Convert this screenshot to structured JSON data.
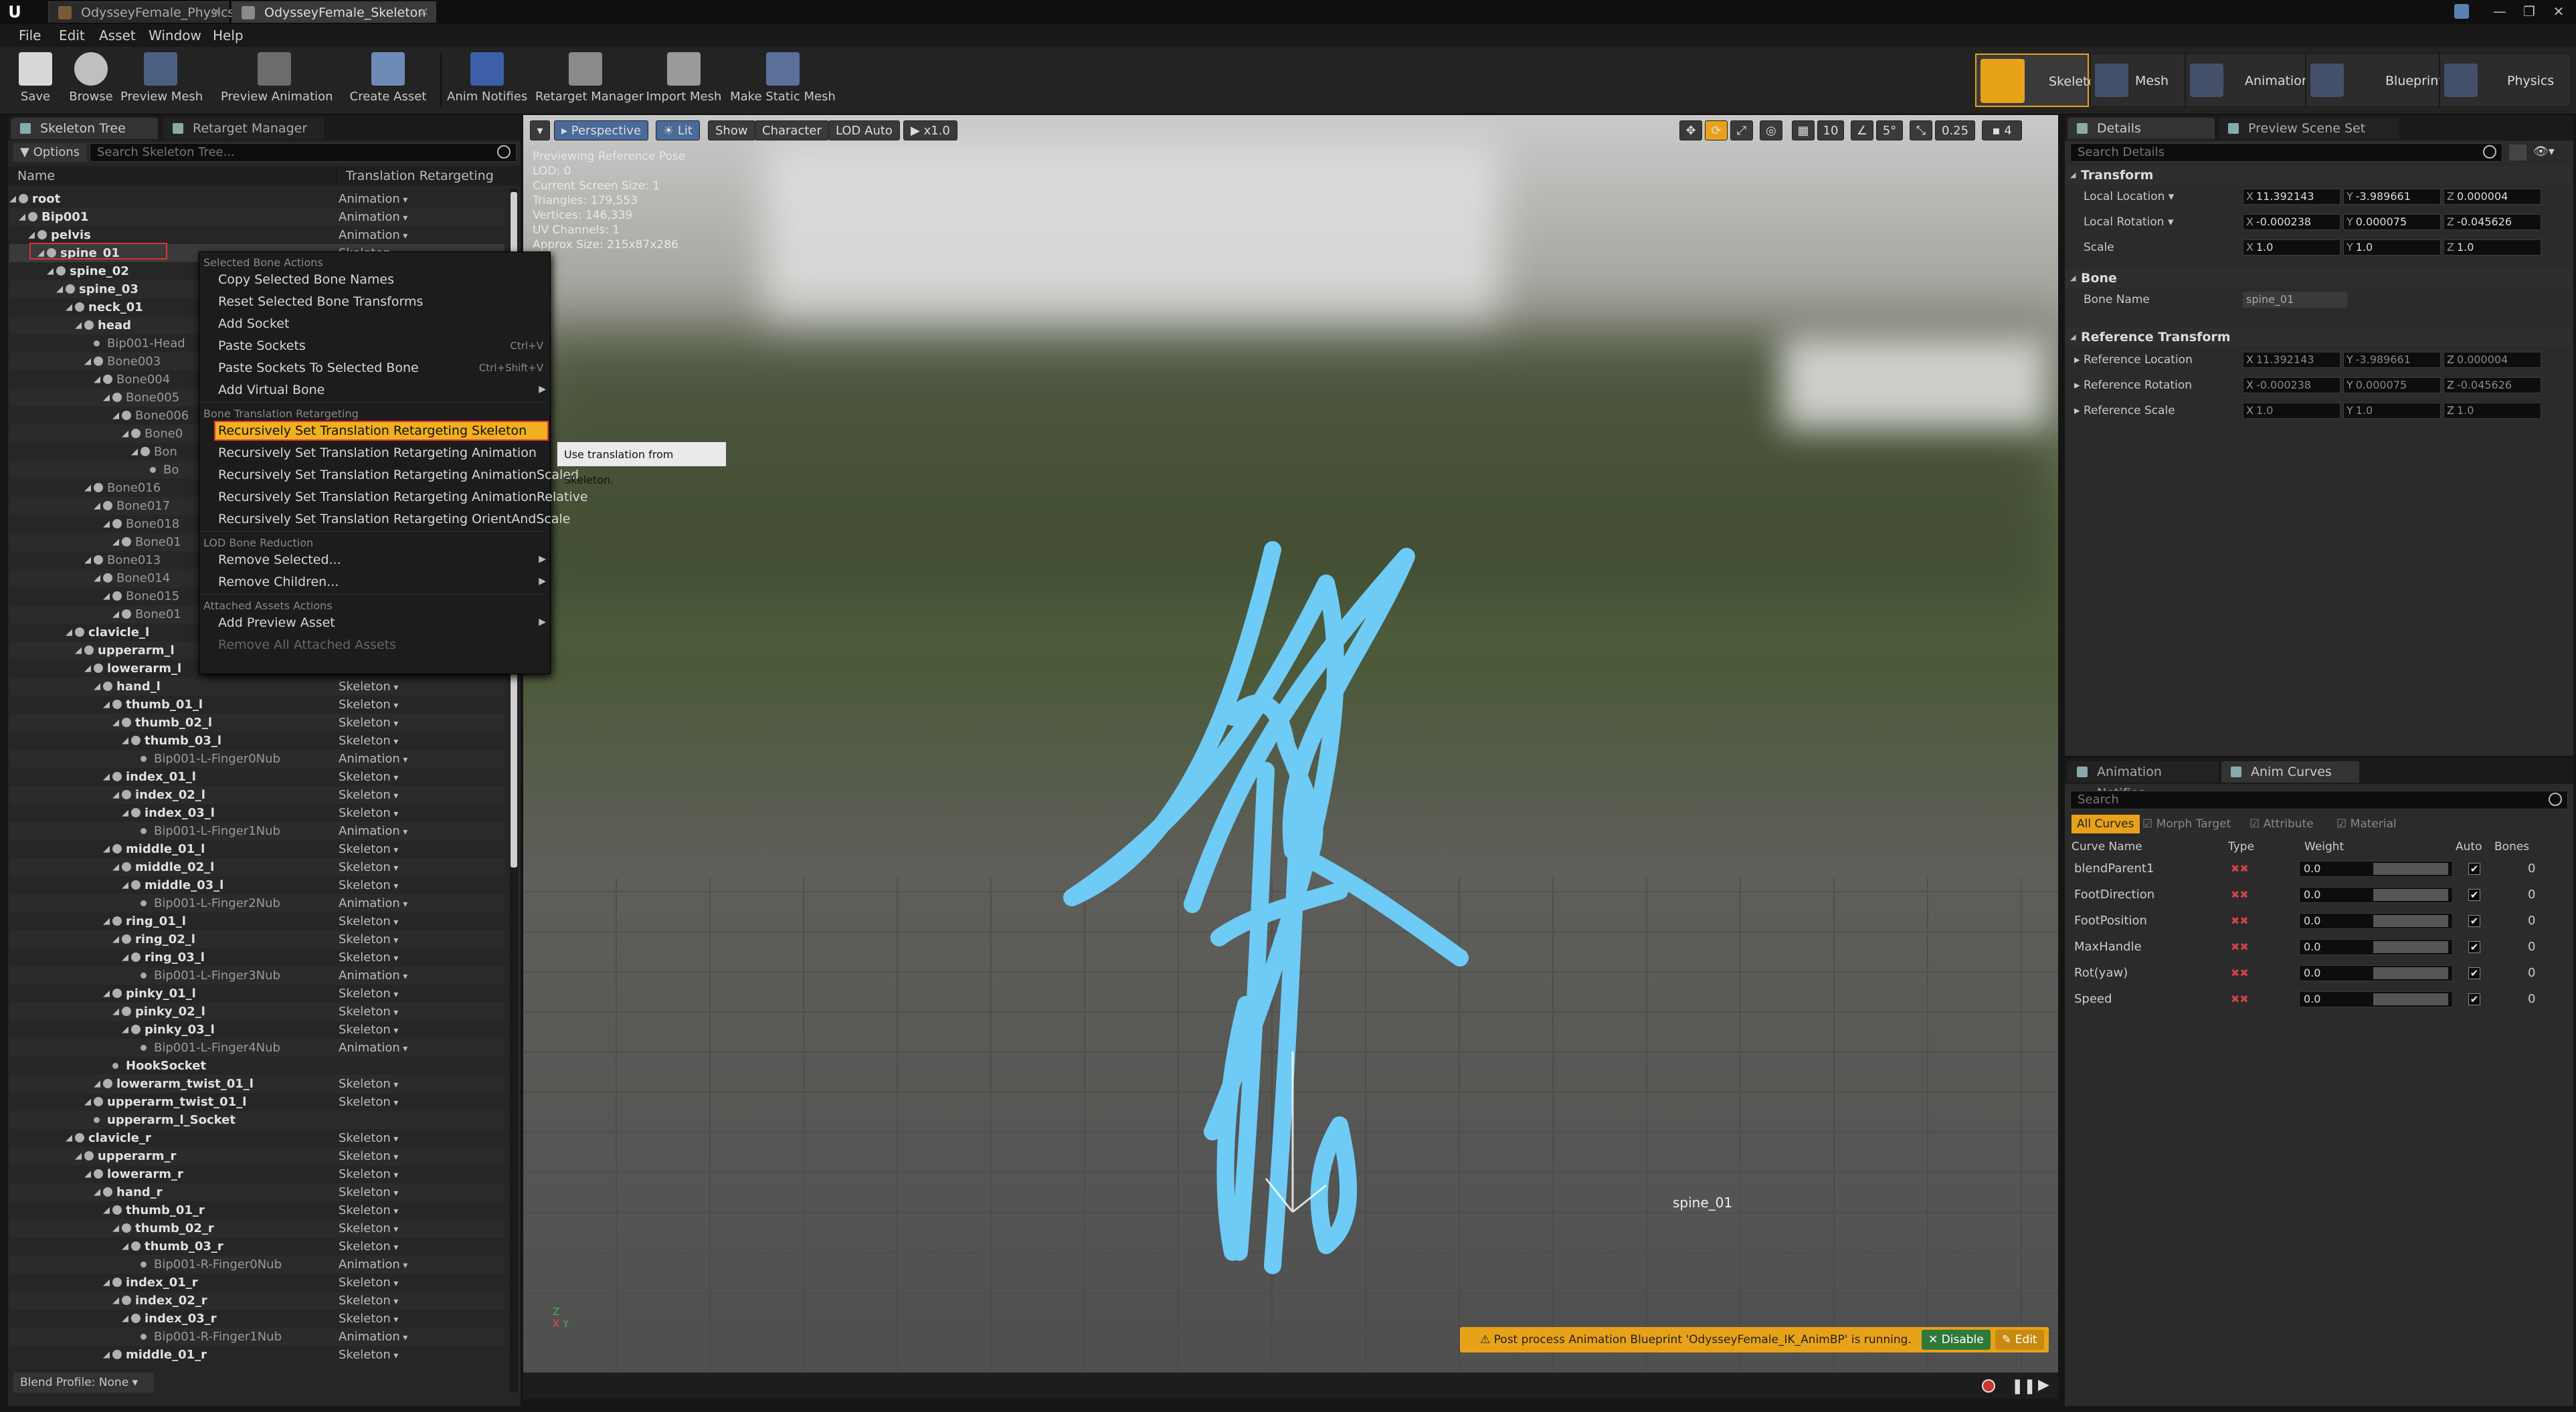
{
  "titlebar": {
    "tabs": [
      {
        "label": "OdysseyFemale_PhysicsA"
      },
      {
        "label": "OdysseyFemale_Skeleton"
      }
    ]
  },
  "menubar": {
    "items": [
      "File",
      "Edit",
      "Asset",
      "Window",
      "Help"
    ]
  },
  "toolbar": {
    "buttons": [
      "Save",
      "Browse",
      "Preview Mesh",
      "Preview Animation",
      "Create Asset",
      "Anim Notifies",
      "Retarget Manager",
      "Import Mesh",
      "Make Static Mesh"
    ],
    "modes": [
      "Skeleton",
      "Mesh",
      "Animation",
      "Blueprint",
      "Physics"
    ]
  },
  "skeleton_tree": {
    "tabs": [
      "Skeleton Tree",
      "Retarget Manager"
    ],
    "options_label": "Options",
    "search_placeholder": "Search Skeleton Tree...",
    "columns": {
      "name": "Name",
      "type": "Translation Retargeting"
    },
    "rows": [
      {
        "name": "root",
        "type": "Animation",
        "depth": 0,
        "kind": "bone"
      },
      {
        "name": "Bip001",
        "type": "Animation",
        "depth": 1,
        "kind": "bone"
      },
      {
        "name": "pelvis",
        "type": "Animation",
        "depth": 2,
        "kind": "bone"
      },
      {
        "name": "spine_01",
        "type": "Skeleton",
        "depth": 3,
        "kind": "bone"
      },
      {
        "name": "spine_02",
        "type": "",
        "depth": 4,
        "kind": "bone"
      },
      {
        "name": "spine_03",
        "type": "",
        "depth": 5,
        "kind": "bone"
      },
      {
        "name": "neck_01",
        "type": "",
        "depth": 6,
        "kind": "bone"
      },
      {
        "name": "head",
        "type": "",
        "depth": 7,
        "kind": "bone"
      },
      {
        "name": "Bip001-Head",
        "type": "",
        "depth": 8,
        "kind": "sock"
      },
      {
        "name": "Bone003",
        "type": "",
        "depth": 8,
        "kind": "dim"
      },
      {
        "name": "Bone004",
        "type": "",
        "depth": 9,
        "kind": "dim"
      },
      {
        "name": "Bone005",
        "type": "",
        "depth": 10,
        "kind": "dim"
      },
      {
        "name": "Bone006",
        "type": "",
        "depth": 11,
        "kind": "dim"
      },
      {
        "name": "Bone0",
        "type": "",
        "depth": 12,
        "kind": "dim"
      },
      {
        "name": "Bon",
        "type": "",
        "depth": 13,
        "kind": "dim"
      },
      {
        "name": "Bo",
        "type": "",
        "depth": 14,
        "kind": "sock"
      },
      {
        "name": "Bone016",
        "type": "",
        "depth": 8,
        "kind": "dim"
      },
      {
        "name": "Bone017",
        "type": "",
        "depth": 9,
        "kind": "dim"
      },
      {
        "name": "Bone018",
        "type": "",
        "depth": 10,
        "kind": "dim"
      },
      {
        "name": "Bone01",
        "type": "",
        "depth": 11,
        "kind": "dim"
      },
      {
        "name": "Bone013",
        "type": "",
        "depth": 8,
        "kind": "dim"
      },
      {
        "name": "Bone014",
        "type": "",
        "depth": 9,
        "kind": "dim"
      },
      {
        "name": "Bone015",
        "type": "",
        "depth": 10,
        "kind": "dim"
      },
      {
        "name": "Bone01",
        "type": "",
        "depth": 11,
        "kind": "dim"
      },
      {
        "name": "clavicle_l",
        "type": "",
        "depth": 6,
        "kind": "bone"
      },
      {
        "name": "upperarm_l",
        "type": "",
        "depth": 7,
        "kind": "bone"
      },
      {
        "name": "lowerarm_l",
        "type": "",
        "depth": 8,
        "kind": "bone"
      },
      {
        "name": "hand_l",
        "type": "Skeleton",
        "depth": 9,
        "kind": "bone"
      },
      {
        "name": "thumb_01_l",
        "type": "Skeleton",
        "depth": 10,
        "kind": "bone"
      },
      {
        "name": "thumb_02_l",
        "type": "Skeleton",
        "depth": 11,
        "kind": "bone"
      },
      {
        "name": "thumb_03_l",
        "type": "Skeleton",
        "depth": 12,
        "kind": "bone"
      },
      {
        "name": "Bip001-L-Finger0Nub",
        "type": "Animation",
        "depth": 13,
        "kind": "sock"
      },
      {
        "name": "index_01_l",
        "type": "Skeleton",
        "depth": 10,
        "kind": "bone"
      },
      {
        "name": "index_02_l",
        "type": "Skeleton",
        "depth": 11,
        "kind": "bone"
      },
      {
        "name": "index_03_l",
        "type": "Skeleton",
        "depth": 12,
        "kind": "bone"
      },
      {
        "name": "Bip001-L-Finger1Nub",
        "type": "Animation",
        "depth": 13,
        "kind": "sock"
      },
      {
        "name": "middle_01_l",
        "type": "Skeleton",
        "depth": 10,
        "kind": "bone"
      },
      {
        "name": "middle_02_l",
        "type": "Skeleton",
        "depth": 11,
        "kind": "bone"
      },
      {
        "name": "middle_03_l",
        "type": "Skeleton",
        "depth": 12,
        "kind": "bone"
      },
      {
        "name": "Bip001-L-Finger2Nub",
        "type": "Animation",
        "depth": 13,
        "kind": "sock"
      },
      {
        "name": "ring_01_l",
        "type": "Skeleton",
        "depth": 10,
        "kind": "bone"
      },
      {
        "name": "ring_02_l",
        "type": "Skeleton",
        "depth": 11,
        "kind": "bone"
      },
      {
        "name": "ring_03_l",
        "type": "Skeleton",
        "depth": 12,
        "kind": "bone"
      },
      {
        "name": "Bip001-L-Finger3Nub",
        "type": "Animation",
        "depth": 13,
        "kind": "sock"
      },
      {
        "name": "pinky_01_l",
        "type": "Skeleton",
        "depth": 10,
        "kind": "bone"
      },
      {
        "name": "pinky_02_l",
        "type": "Skeleton",
        "depth": 11,
        "kind": "bone"
      },
      {
        "name": "pinky_03_l",
        "type": "Skeleton",
        "depth": 12,
        "kind": "bone"
      },
      {
        "name": "Bip001-L-Finger4Nub",
        "type": "Animation",
        "depth": 13,
        "kind": "sock"
      },
      {
        "name": "HookSocket",
        "type": "",
        "depth": 10,
        "kind": "socket"
      },
      {
        "name": "lowerarm_twist_01_l",
        "type": "Skeleton",
        "depth": 9,
        "kind": "bone"
      },
      {
        "name": "upperarm_twist_01_l",
        "type": "Skeleton",
        "depth": 8,
        "kind": "bone"
      },
      {
        "name": "upperarm_l_Socket",
        "type": "",
        "depth": 8,
        "kind": "socket"
      },
      {
        "name": "clavicle_r",
        "type": "Skeleton",
        "depth": 6,
        "kind": "bone"
      },
      {
        "name": "upperarm_r",
        "type": "Skeleton",
        "depth": 7,
        "kind": "bone"
      },
      {
        "name": "lowerarm_r",
        "type": "Skeleton",
        "depth": 8,
        "kind": "bone"
      },
      {
        "name": "hand_r",
        "type": "Skeleton",
        "depth": 9,
        "kind": "bone"
      },
      {
        "name": "thumb_01_r",
        "type": "Skeleton",
        "depth": 10,
        "kind": "bone"
      },
      {
        "name": "thumb_02_r",
        "type": "Skeleton",
        "depth": 11,
        "kind": "bone"
      },
      {
        "name": "thumb_03_r",
        "type": "Skeleton",
        "depth": 12,
        "kind": "bone"
      },
      {
        "name": "Bip001-R-Finger0Nub",
        "type": "Animation",
        "depth": 13,
        "kind": "sock"
      },
      {
        "name": "index_01_r",
        "type": "Skeleton",
        "depth": 10,
        "kind": "bone"
      },
      {
        "name": "index_02_r",
        "type": "Skeleton",
        "depth": 11,
        "kind": "bone"
      },
      {
        "name": "index_03_r",
        "type": "Skeleton",
        "depth": 12,
        "kind": "bone"
      },
      {
        "name": "Bip001-R-Finger1Nub",
        "type": "Animation",
        "depth": 13,
        "kind": "sock"
      },
      {
        "name": "middle_01_r",
        "type": "Skeleton",
        "depth": 10,
        "kind": "bone"
      }
    ],
    "blend_profile": "Blend Profile: None"
  },
  "context_menu": {
    "sections": [
      {
        "header": "Selected Bone Actions",
        "items": [
          {
            "label": "Copy Selected Bone Names",
            "shortcut": "",
            "submenu": false
          },
          {
            "label": "Reset Selected Bone Transforms",
            "shortcut": "",
            "submenu": false
          },
          {
            "label": "Add Socket",
            "shortcut": "",
            "submenu": false
          },
          {
            "label": "Paste Sockets",
            "shortcut": "Ctrl+V",
            "submenu": false
          },
          {
            "label": "Paste Sockets To Selected Bone",
            "shortcut": "Ctrl+Shift+V",
            "submenu": false
          },
          {
            "label": "Add Virtual Bone",
            "shortcut": "",
            "submenu": true
          }
        ]
      },
      {
        "header": "Bone Translation Retargeting",
        "items": [
          {
            "label": "Recursively Set Translation Retargeting Skeleton",
            "shortcut": "",
            "submenu": false,
            "highlighted": true
          },
          {
            "label": "Recursively Set Translation Retargeting Animation",
            "shortcut": "",
            "submenu": false
          },
          {
            "label": "Recursively Set Translation Retargeting AnimationScaled",
            "shortcut": "",
            "submenu": false
          },
          {
            "label": "Recursively Set Translation Retargeting AnimationRelative",
            "shortcut": "",
            "submenu": false
          },
          {
            "label": "Recursively Set Translation Retargeting OrientAndScale",
            "shortcut": "",
            "submenu": false
          }
        ]
      },
      {
        "header": "LOD Bone Reduction",
        "items": [
          {
            "label": "Remove Selected...",
            "shortcut": "",
            "submenu": true
          },
          {
            "label": "Remove Children...",
            "shortcut": "",
            "submenu": true
          }
        ]
      },
      {
        "header": "Attached Assets Actions",
        "items": [
          {
            "label": "Add Preview Asset",
            "shortcut": "",
            "submenu": true
          },
          {
            "label": "Remove All Attached Assets",
            "shortcut": "",
            "submenu": false,
            "disabled": true
          }
        ]
      }
    ],
    "tooltip": "Use translation from Skeleton."
  },
  "viewport": {
    "toolbar": {
      "perspective": "Perspective",
      "lit": "Lit",
      "show": "Show",
      "character": "Character",
      "lod": "LOD Auto",
      "speed": "x1.0",
      "grid_value": "10",
      "angle_value": "5°",
      "scale_value": "0.25",
      "cam_speed": "4"
    },
    "info": [
      "Previewing Reference Pose",
      "LOD: 0",
      "Current Screen Size: 1",
      "Triangles: 179,553",
      "Vertices: 146,339",
      "UV Channels: 1",
      "Approx Size: 215x87x286"
    ],
    "bone_label": "spine_01",
    "notification": {
      "text": "Post process Animation Blueprint 'OdysseyFemale_IK_AnimBP' is running.",
      "disable": "Disable",
      "edit": "Edit"
    }
  },
  "details": {
    "tabs": [
      "Details",
      "Preview Scene Set"
    ],
    "search_placeholder": "Search Details",
    "transform": {
      "title": "Transform",
      "location": {
        "label": "Local Location",
        "x": "11.392143",
        "y": "-3.989661",
        "z": "0.000004"
      },
      "rotation": {
        "label": "Local Rotation",
        "x": "-0.000238",
        "y": "0.000075",
        "z": "-0.045626"
      },
      "scale": {
        "label": "Scale",
        "x": "1.0",
        "y": "1.0",
        "z": "1.0"
      }
    },
    "bone": {
      "title": "Bone",
      "name_label": "Bone Name",
      "name_value": "spine_01"
    },
    "reference": {
      "title": "Reference Transform",
      "location": {
        "label": "Reference Location",
        "x": "11.392143",
        "y": "-3.989661",
        "z": "0.000004"
      },
      "rotation": {
        "label": "Reference Rotation",
        "x": "-0.000238",
        "y": "0.000075",
        "z": "-0.045626"
      },
      "scale": {
        "label": "Reference Scale",
        "x": "1.0",
        "y": "1.0",
        "z": "1.0"
      }
    }
  },
  "curves": {
    "tabs": [
      "Animation Notifies",
      "Anim Curves"
    ],
    "search_placeholder": "Search",
    "filters": [
      "All Curves",
      "Morph Target",
      "Attribute",
      "Material"
    ],
    "columns": [
      "Curve Name",
      "Type",
      "Weight",
      "Auto",
      "Bones"
    ],
    "rows": [
      {
        "name": "blendParent1",
        "weight": "0.0",
        "bones": "0"
      },
      {
        "name": "FootDirection",
        "weight": "0.0",
        "bones": "0"
      },
      {
        "name": "FootPosition",
        "weight": "0.0",
        "bones": "0"
      },
      {
        "name": "MaxHandle",
        "weight": "0.0",
        "bones": "0"
      },
      {
        "name": "Rot(yaw)",
        "weight": "0.0",
        "bones": "0"
      },
      {
        "name": "Speed",
        "weight": "0.0",
        "bones": "0"
      }
    ]
  },
  "colors": {
    "accent": "#e8a21a",
    "highlight": "#f0b020",
    "scribble": "#6ecbf5",
    "selection": "#3b5d9a"
  }
}
